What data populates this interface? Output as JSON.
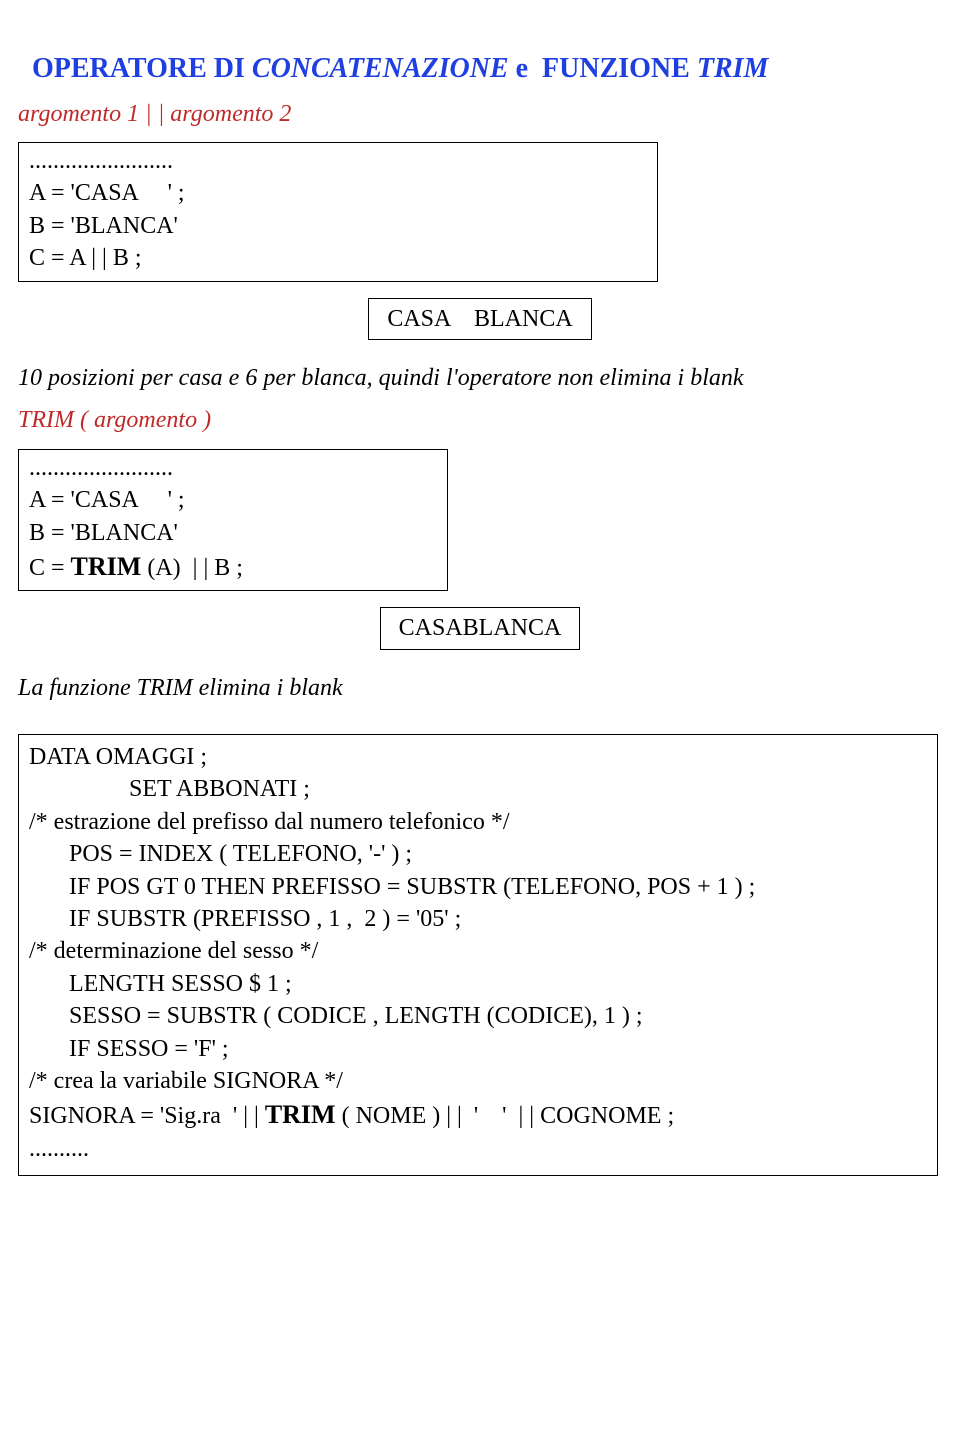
{
  "title": {
    "p1": "OPERATORE DI ",
    "p2": "CONCATENAZIONE",
    "p3": " e  FUNZIONE ",
    "p4": "TRIM"
  },
  "syntax1": "argomento 1 | | argomento 2",
  "box1": {
    "l1": "........................",
    "l2": "A = 'CASA     ' ;",
    "l3": "B = 'BLANCA'",
    "l4": "C = A | | B ;"
  },
  "result1": "CASA    BLANCA",
  "caption1": "10 posizioni per casa e 6 per blanca, quindi l'operatore non elimina i blank",
  "syntax2": "TRIM ( argomento )",
  "box2": {
    "l1": "........................",
    "l2": "A = 'CASA     ' ;",
    "l3": "B = 'BLANCA'",
    "l4a": "C = ",
    "l4b": "TRIM",
    "l4c": " (A)  | | B ;"
  },
  "result2": "CASABLANCA",
  "caption2_pre": "La funzione TRIM ",
  "caption2_post": "elimina i blank",
  "bigbox": {
    "l1": "DATA OMAGGI ;",
    "l2": "SET ABBONATI ;",
    "l3": "/* estrazione del prefisso dal numero telefonico */",
    "l4": "POS = INDEX ( TELEFONO, '-' ) ;",
    "l5": "IF POS GT 0 THEN PREFISSO = SUBSTR (TELEFONO, POS + 1 ) ;",
    "l6": "IF SUBSTR (PREFISSO , 1 ,  2 ) = '05' ;",
    "l7": "/* determinazione del sesso */",
    "l8": "LENGTH SESSO $ 1 ;",
    "l9": "SESSO = SUBSTR ( CODICE , LENGTH (CODICE), 1 ) ;",
    "l10": "IF SESSO = 'F' ;",
    "l11": "/* crea la variabile SIGNORA */",
    "l12a": "SIGNORA = 'Sig.ra  ' | | ",
    "l12b": "TRIM",
    "l12c": " ( NOME ) | |  '    '  | | COGNOME ;",
    "l13": ".........."
  }
}
